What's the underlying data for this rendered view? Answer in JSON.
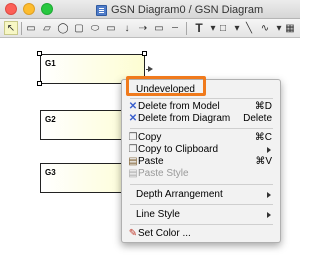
{
  "window": {
    "title": "GSN Diagram0 / GSN Diagram"
  },
  "toolbar": {
    "tools": [
      {
        "icon": "pointer-icon",
        "glyph": "↖"
      },
      {
        "icon": "goal-shape-icon",
        "glyph": "▭"
      },
      {
        "icon": "strategy-shape-icon",
        "glyph": "▱"
      },
      {
        "icon": "solution-shape-icon",
        "glyph": "◯"
      },
      {
        "icon": "context-shape-icon",
        "glyph": "▢"
      },
      {
        "icon": "assumption-shape-icon",
        "glyph": "⬭"
      },
      {
        "icon": "module-shape-icon",
        "glyph": "▭"
      },
      {
        "icon": "arrow-down-icon",
        "glyph": "↓"
      },
      {
        "icon": "arrow-right-icon",
        "glyph": "⇢"
      },
      {
        "icon": "rectangle-icon",
        "glyph": "▭"
      },
      {
        "icon": "dashed-line-icon",
        "glyph": "┄"
      },
      {
        "icon": "text-tool-icon",
        "glyph": "T"
      },
      {
        "icon": "rectangle-tool-icon",
        "glyph": "□"
      },
      {
        "icon": "line-tool-icon",
        "glyph": "╲"
      },
      {
        "icon": "curve-tool-icon",
        "glyph": "∿"
      }
    ]
  },
  "diagram": {
    "nodes": [
      {
        "label": "G1"
      },
      {
        "label": "G2"
      },
      {
        "label": "G3"
      }
    ]
  },
  "context_menu": {
    "undeveloped": "Undeveloped",
    "delete_from_model": "Delete from Model",
    "delete_from_model_shortcut": "⌘D",
    "delete_from_diagram": "Delete from Diagram",
    "delete_from_diagram_shortcut": "Delete",
    "copy": "Copy",
    "copy_shortcut": "⌘C",
    "copy_to_clipboard": "Copy to Clipboard",
    "paste": "Paste",
    "paste_shortcut": "⌘V",
    "paste_style": "Paste Style",
    "depth_arrangement": "Depth Arrangement",
    "line_style": "Line Style",
    "set_color": "Set Color ..."
  },
  "colors": {
    "highlight_box": "#f07a1c",
    "menu_selection": "#3f7fd9",
    "delete_icon": "#3a5fcd"
  }
}
